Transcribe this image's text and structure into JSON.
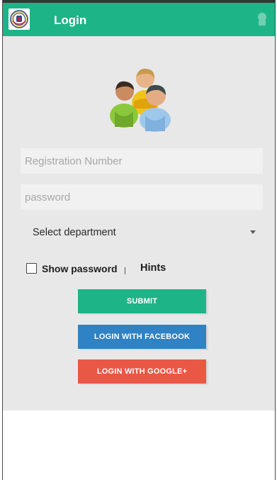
{
  "app_bar": {
    "title": "Login",
    "logo_icon": "college-emblem-icon",
    "action_icon": "overflow-icon",
    "color": "#1db487"
  },
  "login_form": {
    "illustration_icon": "users-group-icon",
    "registration_placeholder": "Registration Number",
    "registration_value": "",
    "password_placeholder": "password",
    "password_value": "",
    "department_select": {
      "selected": "Select department"
    },
    "show_password": {
      "label": "Show password",
      "checked": false
    },
    "hints_label": "Hints",
    "submit_label": "SUBMIT",
    "facebook_label": "LOGIN WITH FACEBOOK",
    "google_label": "LOGIN WITH GOOGLE+"
  },
  "colors": {
    "accent": "#1db487",
    "facebook": "#2f82c3",
    "google": "#ea5744",
    "background": "#e8e8e8"
  }
}
